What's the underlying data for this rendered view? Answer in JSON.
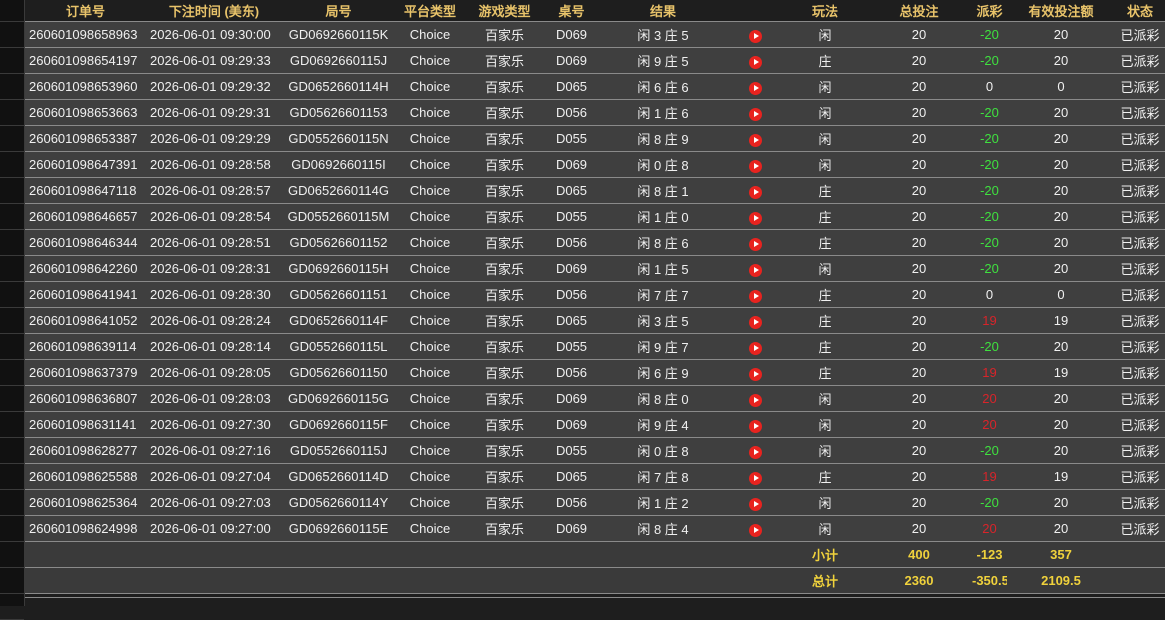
{
  "columns": [
    "订单号",
    "下注时间 (美东)",
    "局号",
    "平台类型",
    "游戏类型",
    "桌号",
    "结果",
    "",
    "玩法",
    "总投注",
    "派彩",
    "有效投注额",
    "状态"
  ],
  "icon": "play-icon",
  "rows": [
    {
      "order": "260601098658963",
      "time": "2026-06-01 09:30:00",
      "round": "GD0692660115K",
      "platform": "Choice",
      "game": "百家乐",
      "table": "D069",
      "result": "闲 3 庄 5",
      "play": "闲",
      "bet": "20",
      "payout": "-20",
      "payout_color": "green",
      "valid": "20",
      "status": "已派彩"
    },
    {
      "order": "260601098654197",
      "time": "2026-06-01 09:29:33",
      "round": "GD0692660115J",
      "platform": "Choice",
      "game": "百家乐",
      "table": "D069",
      "result": "闲 9 庄 5",
      "play": "庄",
      "bet": "20",
      "payout": "-20",
      "payout_color": "green",
      "valid": "20",
      "status": "已派彩"
    },
    {
      "order": "260601098653960",
      "time": "2026-06-01 09:29:32",
      "round": "GD0652660114H",
      "platform": "Choice",
      "game": "百家乐",
      "table": "D065",
      "result": "闲 6 庄 6",
      "play": "闲",
      "bet": "20",
      "payout": "0",
      "payout_color": "white",
      "valid": "0",
      "status": "已派彩"
    },
    {
      "order": "260601098653663",
      "time": "2026-06-01 09:29:31",
      "round": "GD05626601153",
      "platform": "Choice",
      "game": "百家乐",
      "table": "D056",
      "result": "闲 1 庄 6",
      "play": "闲",
      "bet": "20",
      "payout": "-20",
      "payout_color": "green",
      "valid": "20",
      "status": "已派彩"
    },
    {
      "order": "260601098653387",
      "time": "2026-06-01 09:29:29",
      "round": "GD0552660115N",
      "platform": "Choice",
      "game": "百家乐",
      "table": "D055",
      "result": "闲 8 庄 9",
      "play": "闲",
      "bet": "20",
      "payout": "-20",
      "payout_color": "green",
      "valid": "20",
      "status": "已派彩"
    },
    {
      "order": "260601098647391",
      "time": "2026-06-01 09:28:58",
      "round": "GD0692660115I",
      "platform": "Choice",
      "game": "百家乐",
      "table": "D069",
      "result": "闲 0 庄 8",
      "play": "闲",
      "bet": "20",
      "payout": "-20",
      "payout_color": "green",
      "valid": "20",
      "status": "已派彩"
    },
    {
      "order": "260601098647118",
      "time": "2026-06-01 09:28:57",
      "round": "GD0652660114G",
      "platform": "Choice",
      "game": "百家乐",
      "table": "D065",
      "result": "闲 8 庄 1",
      "play": "庄",
      "bet": "20",
      "payout": "-20",
      "payout_color": "green",
      "valid": "20",
      "status": "已派彩"
    },
    {
      "order": "260601098646657",
      "time": "2026-06-01 09:28:54",
      "round": "GD0552660115M",
      "platform": "Choice",
      "game": "百家乐",
      "table": "D055",
      "result": "闲 1 庄 0",
      "play": "庄",
      "bet": "20",
      "payout": "-20",
      "payout_color": "green",
      "valid": "20",
      "status": "已派彩"
    },
    {
      "order": "260601098646344",
      "time": "2026-06-01 09:28:51",
      "round": "GD05626601152",
      "platform": "Choice",
      "game": "百家乐",
      "table": "D056",
      "result": "闲 8 庄 6",
      "play": "庄",
      "bet": "20",
      "payout": "-20",
      "payout_color": "green",
      "valid": "20",
      "status": "已派彩"
    },
    {
      "order": "260601098642260",
      "time": "2026-06-01 09:28:31",
      "round": "GD0692660115H",
      "platform": "Choice",
      "game": "百家乐",
      "table": "D069",
      "result": "闲 1 庄 5",
      "play": "闲",
      "bet": "20",
      "payout": "-20",
      "payout_color": "green",
      "valid": "20",
      "status": "已派彩"
    },
    {
      "order": "260601098641941",
      "time": "2026-06-01 09:28:30",
      "round": "GD05626601151",
      "platform": "Choice",
      "game": "百家乐",
      "table": "D056",
      "result": "闲 7 庄 7",
      "play": "庄",
      "bet": "20",
      "payout": "0",
      "payout_color": "white",
      "valid": "0",
      "status": "已派彩"
    },
    {
      "order": "260601098641052",
      "time": "2026-06-01 09:28:24",
      "round": "GD0652660114F",
      "platform": "Choice",
      "game": "百家乐",
      "table": "D065",
      "result": "闲 3 庄 5",
      "play": "庄",
      "bet": "20",
      "payout": "19",
      "payout_color": "red",
      "valid": "19",
      "status": "已派彩"
    },
    {
      "order": "260601098639114",
      "time": "2026-06-01 09:28:14",
      "round": "GD0552660115L",
      "platform": "Choice",
      "game": "百家乐",
      "table": "D055",
      "result": "闲 9 庄 7",
      "play": "庄",
      "bet": "20",
      "payout": "-20",
      "payout_color": "green",
      "valid": "20",
      "status": "已派彩"
    },
    {
      "order": "260601098637379",
      "time": "2026-06-01 09:28:05",
      "round": "GD05626601150",
      "platform": "Choice",
      "game": "百家乐",
      "table": "D056",
      "result": "闲 6 庄 9",
      "play": "庄",
      "bet": "20",
      "payout": "19",
      "payout_color": "red",
      "valid": "19",
      "status": "已派彩"
    },
    {
      "order": "260601098636807",
      "time": "2026-06-01 09:28:03",
      "round": "GD0692660115G",
      "platform": "Choice",
      "game": "百家乐",
      "table": "D069",
      "result": "闲 8 庄 0",
      "play": "闲",
      "bet": "20",
      "payout": "20",
      "payout_color": "red",
      "valid": "20",
      "status": "已派彩"
    },
    {
      "order": "260601098631141",
      "time": "2026-06-01 09:27:30",
      "round": "GD0692660115F",
      "platform": "Choice",
      "game": "百家乐",
      "table": "D069",
      "result": "闲 9 庄 4",
      "play": "闲",
      "bet": "20",
      "payout": "20",
      "payout_color": "red",
      "valid": "20",
      "status": "已派彩"
    },
    {
      "order": "260601098628277",
      "time": "2026-06-01 09:27:16",
      "round": "GD0552660115J",
      "platform": "Choice",
      "game": "百家乐",
      "table": "D055",
      "result": "闲 0 庄 8",
      "play": "闲",
      "bet": "20",
      "payout": "-20",
      "payout_color": "green",
      "valid": "20",
      "status": "已派彩"
    },
    {
      "order": "260601098625588",
      "time": "2026-06-01 09:27:04",
      "round": "GD0652660114D",
      "platform": "Choice",
      "game": "百家乐",
      "table": "D065",
      "result": "闲 7 庄 8",
      "play": "庄",
      "bet": "20",
      "payout": "19",
      "payout_color": "red",
      "valid": "19",
      "status": "已派彩"
    },
    {
      "order": "260601098625364",
      "time": "2026-06-01 09:27:03",
      "round": "GD0562660114Y",
      "platform": "Choice",
      "game": "百家乐",
      "table": "D056",
      "result": "闲 1 庄 2",
      "play": "闲",
      "bet": "20",
      "payout": "-20",
      "payout_color": "green",
      "valid": "20",
      "status": "已派彩"
    },
    {
      "order": "260601098624998",
      "time": "2026-06-01 09:27:00",
      "round": "GD0692660115E",
      "platform": "Choice",
      "game": "百家乐",
      "table": "D069",
      "result": "闲 8 庄 4",
      "play": "闲",
      "bet": "20",
      "payout": "20",
      "payout_color": "red",
      "valid": "20",
      "status": "已派彩"
    }
  ],
  "subtotal": {
    "label": "小计",
    "bet": "400",
    "payout": "-123",
    "valid": "357"
  },
  "total": {
    "label": "总计",
    "bet": "2360",
    "payout": "-350.5",
    "valid": "2109.5"
  },
  "colors": {
    "header": "#e8c36a",
    "green": "#3fe03f",
    "red": "#d8242a",
    "sum": "#f0d23c",
    "row_bg": "#3f3f3f"
  }
}
